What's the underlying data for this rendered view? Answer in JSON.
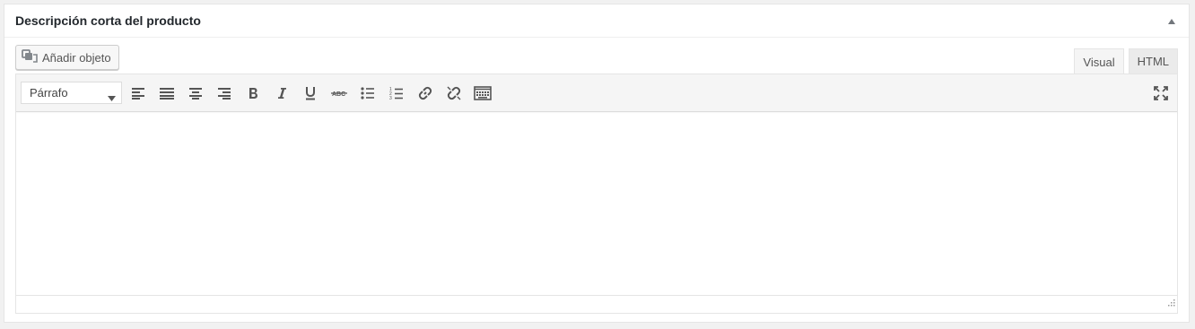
{
  "postbox": {
    "title": "Descripción corta del producto",
    "toggle_icon": "arrow-up-icon"
  },
  "media": {
    "button_label": "Añadir objeto",
    "icon": "media-add-icon"
  },
  "tabs": [
    {
      "label": "Visual",
      "active": true
    },
    {
      "label": "HTML",
      "active": false
    }
  ],
  "toolbar": {
    "format_value": "Párrafo",
    "buttons": [
      "align-left-icon",
      "align-justify-icon",
      "align-center-icon",
      "align-right-icon",
      "bold-icon",
      "italic-icon",
      "underline-icon",
      "strikethrough-icon",
      "bullet-list-icon",
      "numbered-list-icon",
      "link-icon",
      "unlink-icon",
      "toolbar-toggle-icon",
      "fullscreen-icon"
    ]
  },
  "editor": {
    "content": ""
  },
  "colors": {
    "background": "#f1f1f1",
    "panel": "#ffffff",
    "toolbar": "#f5f5f5",
    "icon": "#555555",
    "text": "#23282d"
  }
}
